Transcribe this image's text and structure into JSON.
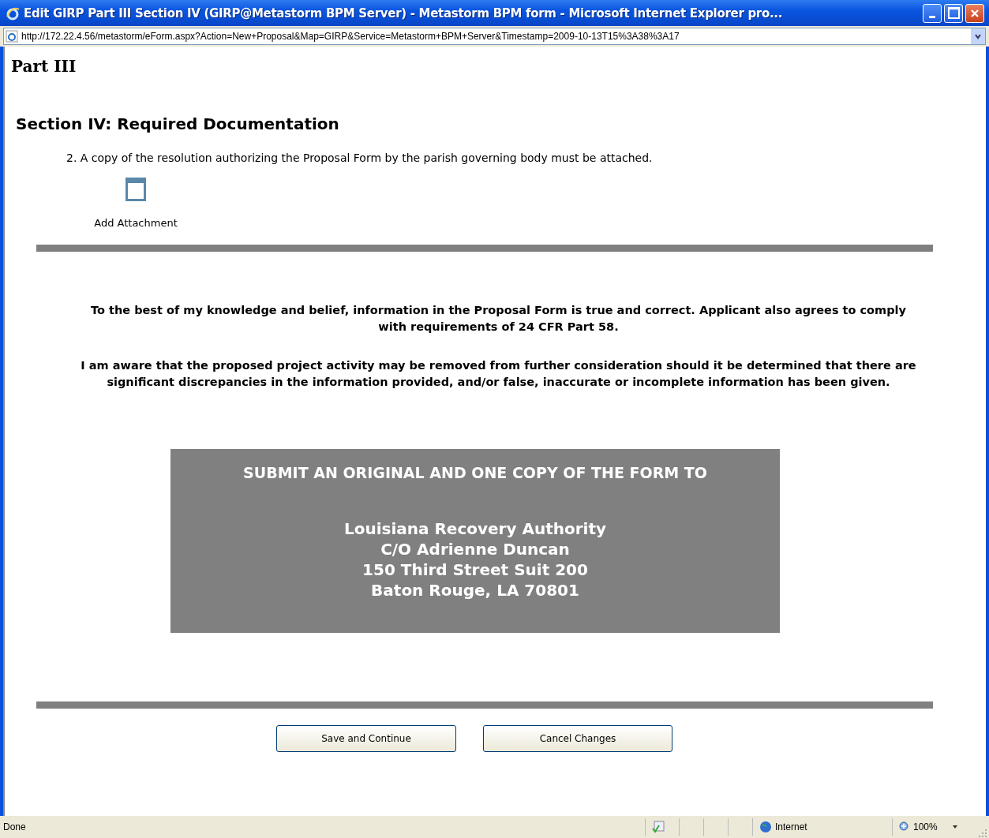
{
  "window": {
    "title": "Edit GIRP Part III Section IV (GIRP@Metastorm BPM Server) - Metastorm BPM form - Microsoft Internet Explorer pro..."
  },
  "address_bar": {
    "value": "http://172.22.4.56/metastorm/eForm.aspx?Action=New+Proposal&Map=GIRP&Service=Metastorm+BPM+Server&Timestamp=2009-10-13T15%3A38%3A17"
  },
  "form": {
    "part_title": "Part III",
    "section_title": "Section IV: Required Documentation",
    "instruction": "2. A copy of the resolution authorizing the Proposal Form by the parish governing body must be attached.",
    "attachment_label": "Add Attachment",
    "statements": [
      "To the best of my knowledge and belief, information in the Proposal Form is true and correct. Applicant also agrees to comply with requirements of 24 CFR Part 58.",
      "I am aware that the proposed project activity may be removed from further consideration should it be determined that there are significant discrepancies in the information provided, and/or false, inaccurate or incomplete information has been given."
    ],
    "submit_box": {
      "heading": "SUBMIT AN ORIGINAL AND ONE COPY OF THE FORM TO",
      "address_lines": [
        "Louisiana Recovery Authority",
        "C/O Adrienne Duncan",
        "150 Third Street Suit 200",
        "Baton Rouge, LA 70801"
      ]
    },
    "buttons": [
      "Save and Continue",
      "Cancel Changes"
    ]
  },
  "status_bar": {
    "status": "Done",
    "zone": "Internet",
    "zoom": "100%"
  }
}
